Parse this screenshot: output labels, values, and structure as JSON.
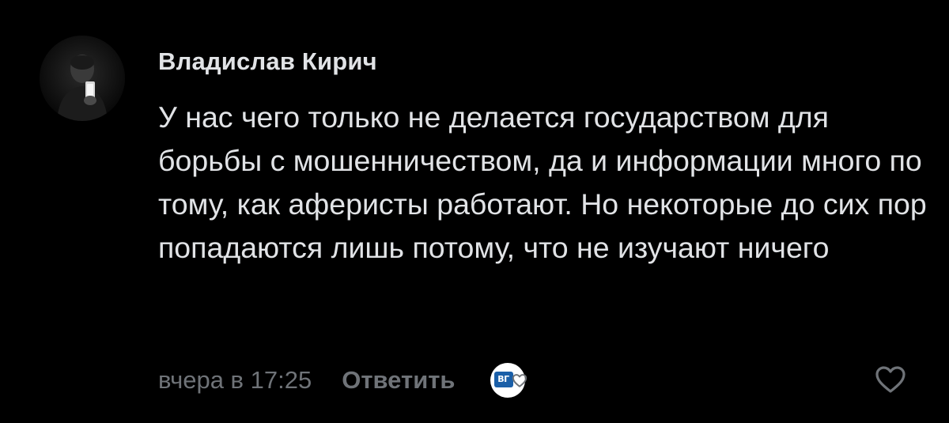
{
  "comment": {
    "author": "Владислав Кирич",
    "text": "У нас чего только не делается государством для борьбы с мошенничеством, да и информации много по тому, как аферисты работают. Но некоторые до сих пор попадаются лишь потому, что не изучают ничего",
    "timestamp": "вчера в 17:25",
    "reply_label": "Ответить",
    "reaction_badge_text": "ВГ"
  },
  "icons": {
    "avatar": "user-avatar-photo",
    "reaction": "reaction-badge-icon",
    "like": "heart-outline-icon"
  },
  "colors": {
    "background": "#000000",
    "primary_text": "#e1e3e6",
    "secondary_text": "#6f7378",
    "badge_blue": "#1a5fa8"
  }
}
